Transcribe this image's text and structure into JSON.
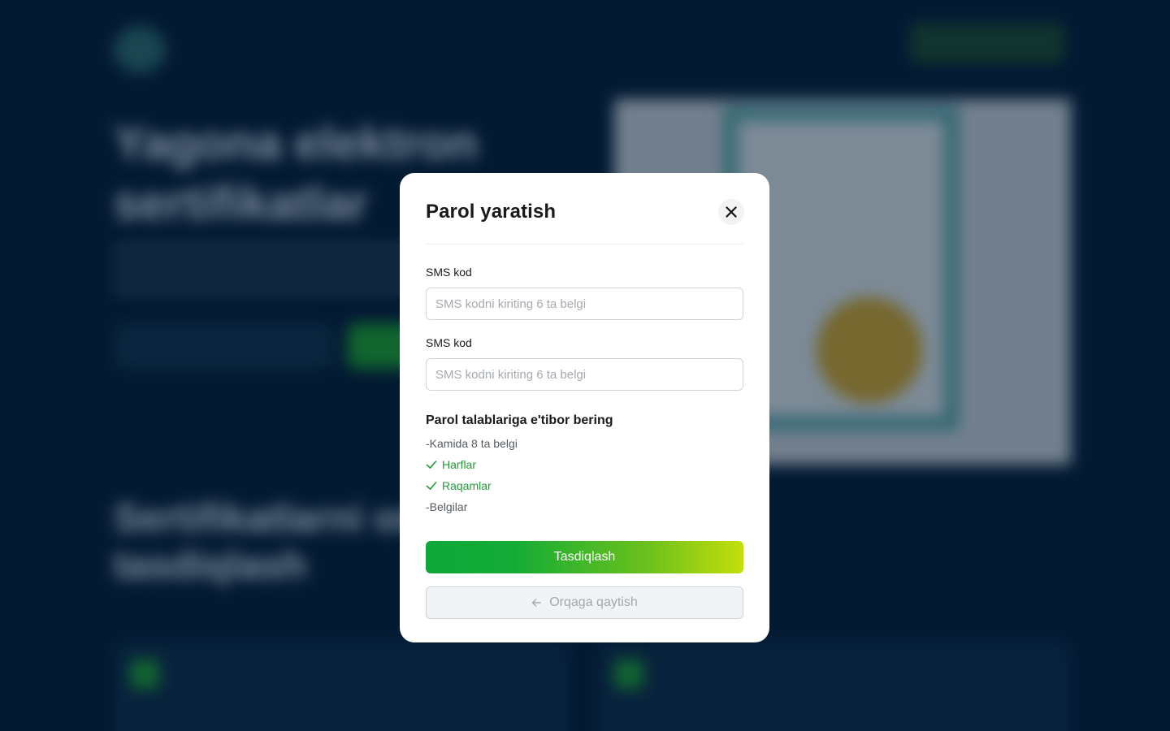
{
  "background": {
    "hero_title": "Yagona elektron sertifikatlar",
    "section_title": "Sertifikatlarni onlayn tasdiqlash"
  },
  "modal": {
    "title": "Parol yaratish",
    "close_icon": "close-icon",
    "fields": [
      {
        "label": "SMS kod",
        "placeholder": "SMS kodni kiriting 6 ta belgi",
        "value": ""
      },
      {
        "label": "SMS kod",
        "placeholder": "SMS kodni kiriting 6 ta belgi",
        "value": ""
      }
    ],
    "requirements": {
      "title": "Parol talablariga e'tibor bering",
      "items": [
        {
          "text": "-Kamida 8 ta belgi",
          "met": false
        },
        {
          "text": "Harflar",
          "met": true,
          "icon": "check-icon"
        },
        {
          "text": "Raqamlar",
          "met": true,
          "icon": "check-icon"
        },
        {
          "text": "-Belgilar",
          "met": false
        }
      ]
    },
    "confirm_label": "Tasdiqlash",
    "back_label": "Orqaga qaytish",
    "back_icon": "arrow-left-icon"
  },
  "colors": {
    "success": "#1f9e35",
    "gradient_start": "#0ca83a",
    "gradient_end": "#c4df0a",
    "overlay": "#031a33"
  }
}
